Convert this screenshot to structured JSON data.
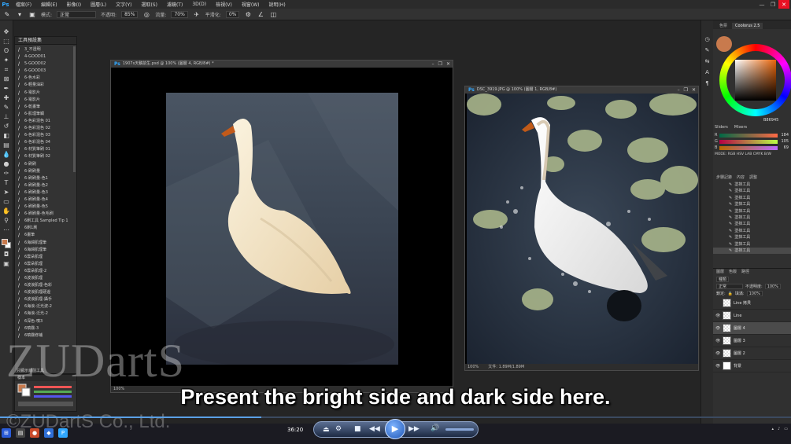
{
  "menubar": {
    "logo": "Ps",
    "items": [
      "檔案(F)",
      "編輯(E)",
      "影像(I)",
      "圖層(L)",
      "文字(Y)",
      "選取(S)",
      "濾鏡(T)",
      "3D(D)",
      "檢視(V)",
      "視窗(W)",
      "說明(H)"
    ],
    "window_controls": [
      "—",
      "❐",
      "✕"
    ]
  },
  "options_bar": {
    "mode_label": "模式:",
    "mode_value": "正常",
    "opacity_label": "不透明:",
    "opacity_value": "85%",
    "flow_label": "流量:",
    "flow_value": "70%",
    "smoothing_label": "平滑化:",
    "smoothing_value": "0%"
  },
  "brush_panel": {
    "title": "工具預設集",
    "items": [
      "3_不透明",
      "4-GOOD01",
      "5-GOOD02",
      "6-GOOD03",
      "6-色水彩",
      "6-輕量油彩",
      "6-電影片",
      "6-電影片",
      "6-乾畫筆",
      "6-肌理筆觸",
      "6-色彩混色 01",
      "6-色彩混色 02",
      "6-色彩混色 03",
      "6-色彩混色 04",
      "6-材質筆刷 01",
      "6-材質筆刷 02",
      "6-刷刷",
      "6-刷刷量",
      "6-刷刷量-色1",
      "6-刷刷量-色2",
      "6-刷刷量-色3",
      "6-刷刷量-色4",
      "6-刷刷量-色5",
      "6-刷刷量-色毛刷",
      "6刷工具 Sampled Tip 1",
      "6刷1刷",
      "6畫筆",
      "6海綿肌理筆",
      "6海綿肌理筆",
      "6雲朵肌理",
      "6雲朵肌理",
      "6雲朵肌理-2",
      "6波浪肌理",
      "6波浪肌理-色彩",
      "6波浪肌理硬邊",
      "6波浪肌理-攝手",
      "6海浪-泛光波-2",
      "6海浪-泛光-2",
      "6深色-噴3",
      "6噴霧-3",
      "6噴霧修補"
    ],
    "footer": "只顯示目前工具"
  },
  "mini_panel": {
    "title": "樣本"
  },
  "doc_left": {
    "title": "1907s天鵝前生.psd @ 100% (圖層 4, RGB/8#) *",
    "status_zoom": "100%"
  },
  "doc_right": {
    "title": "DSC_3919.JPG @ 100% (圖層 1, RGB/8#)",
    "status_zoom": "100%",
    "status_doc": "文件: 1.89M/1.89M"
  },
  "right_panel": {
    "tabs": [
      "色票",
      "Coolorus 2.5"
    ],
    "sliders_header": [
      "Sliders",
      "Mixers"
    ],
    "hex": "B86945",
    "sliders": [
      {
        "channel": "R",
        "value": "184"
      },
      {
        "channel": "G",
        "value": "105"
      },
      {
        "channel": "B",
        "value": "69"
      }
    ],
    "mode_line": "MODE: RGB HSV LAB CMYK B/W",
    "history_tabs": [
      "步驟記錄",
      "內容",
      "調整"
    ],
    "history_items": [
      "塗抹工具",
      "塗抹工具",
      "塗抹工具",
      "塗抹工具",
      "塗抹工具",
      "塗抹工具",
      "塗抹工具",
      "塗抹工具",
      "塗抹工具",
      "塗抹工具",
      "塗抹工具"
    ],
    "layers_tabs": [
      "圖層",
      "色版",
      "路徑"
    ],
    "layers_kind": "種類",
    "layers_blend": "正常",
    "layers_opacity_label": "不透明度:",
    "layers_opacity": "100%",
    "layers_lock_label": "鎖定:",
    "layers_fill_label": "填滿:",
    "layers_fill": "100%",
    "layers": [
      {
        "name": "Line 拷貝",
        "visible": "",
        "thumb": "checker"
      },
      {
        "name": "Line",
        "visible": "👁",
        "thumb": "checker"
      },
      {
        "name": "圖層 4",
        "visible": "👁",
        "thumb": "checker",
        "selected": "yes"
      },
      {
        "name": "圖層 3",
        "visible": "👁",
        "thumb": "checker"
      },
      {
        "name": "圖層 2",
        "visible": "👁",
        "thumb": "checker"
      },
      {
        "name": "背景",
        "visible": "👁",
        "thumb": "white"
      }
    ]
  },
  "player": {
    "timecode": "36:20",
    "progress_fraction": 0.33,
    "volume_fraction": 0.9
  },
  "subtitle": "Present the bright side and dark side here.",
  "watermark": "ZUDartS",
  "copyright": "©ZUDartS Co., Ltd.",
  "colors": {
    "foreground": "#c87a4d",
    "accent": "#31a8ff",
    "close": "#e81123"
  }
}
